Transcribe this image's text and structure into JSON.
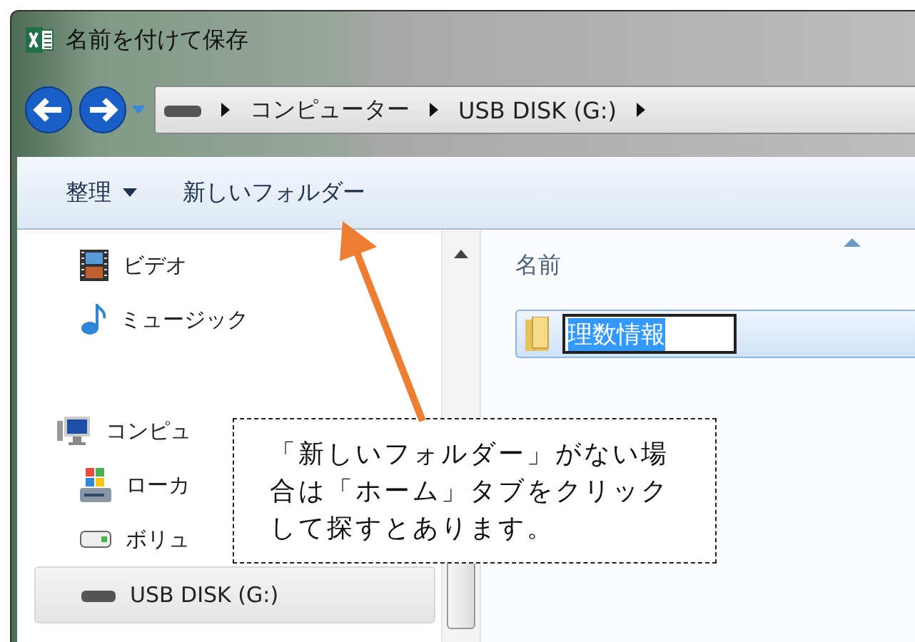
{
  "window": {
    "title": "名前を付けて保存"
  },
  "breadcrumb": [
    "コンピューター",
    "USB DISK (G:)"
  ],
  "toolbar": [
    {
      "label": "整理",
      "dropdown": true
    },
    {
      "label": "新しいフォルダー",
      "dropdown": false
    }
  ],
  "sidebar": {
    "items": [
      {
        "label": "ビデオ",
        "kind": "video",
        "selected": false
      },
      {
        "label": "ミュージック",
        "kind": "music",
        "selected": false
      },
      {
        "label": "コンピュ",
        "kind": "computer",
        "selected": false
      },
      {
        "label": "ローカ",
        "kind": "localdisk",
        "selected": false
      },
      {
        "label": "ボリュ",
        "kind": "volume",
        "selected": false
      },
      {
        "label": "USB DISK (G:)",
        "kind": "usb",
        "selected": true
      }
    ]
  },
  "file_list": {
    "columns": [
      "名前"
    ],
    "rows": [
      {
        "name": "理数情報",
        "editing": true
      }
    ]
  },
  "callout": {
    "text": "「新しいフォルダー」がない場合は「ホーム」タブをクリックして探すとあります。"
  }
}
